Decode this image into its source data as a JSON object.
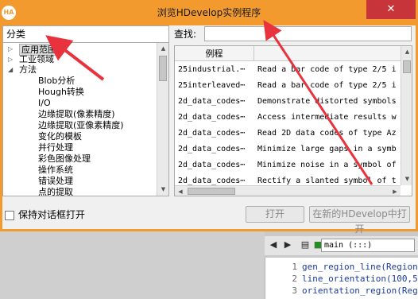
{
  "window": {
    "title": "浏览HDevelop实例程序",
    "app_icon_text": "HA",
    "close_symbol": "✕"
  },
  "left_pane": {
    "header": "分类",
    "tree": [
      {
        "label": "应用范围",
        "level": 0,
        "expanded": false,
        "selected": true
      },
      {
        "label": "工业领域",
        "level": 0,
        "expanded": false
      },
      {
        "label": "方法",
        "level": 0,
        "expanded": true
      },
      {
        "label": "Blob分析",
        "level": 1
      },
      {
        "label": "Hough转换",
        "level": 1
      },
      {
        "label": "I/O",
        "level": 1
      },
      {
        "label": "边缘提取(像素精度)",
        "level": 1
      },
      {
        "label": "边缘提取(亚像素精度)",
        "level": 1
      },
      {
        "label": "变化的模板",
        "level": 1
      },
      {
        "label": "并行处理",
        "level": 1
      },
      {
        "label": "彩色图像处理",
        "level": 1
      },
      {
        "label": "操作系统",
        "level": 1
      },
      {
        "label": "错误处理",
        "level": 1
      },
      {
        "label": "点的提取",
        "level": 1
      }
    ]
  },
  "right_pane": {
    "search_label": "查找:",
    "search_value": "",
    "column_header": "例程",
    "rows": [
      {
        "name": "25industrial.⋯",
        "description": "Read a bar code of type 2/5 i"
      },
      {
        "name": "25interleaved⋯",
        "description": "Read a bar code of type 2/5 i"
      },
      {
        "name": "2d_data_codes⋯",
        "description": "Demonstrate distorted symbols"
      },
      {
        "name": "2d_data_codes⋯",
        "description": "Access intermediate results w"
      },
      {
        "name": "2d_data_codes⋯",
        "description": "Read 2D data codes of type Az"
      },
      {
        "name": "2d_data_codes⋯",
        "description": "Minimize large gaps in a symb"
      },
      {
        "name": "2d_data_codes⋯",
        "description": "Minimize noise in a symbol of"
      },
      {
        "name": "2d_data_codes⋯",
        "description": "Rectify a slanted symbol of t"
      }
    ]
  },
  "footer": {
    "keep_open_label": "保持对话框打开",
    "keep_open_checked": false,
    "open_button": "打开",
    "open_new_button": "在新的HDevelop中打开"
  },
  "editor": {
    "procedure": "main (:::)",
    "lines": [
      {
        "number": "1",
        "code": "gen_region_line(Region"
      },
      {
        "number": "2",
        "code": "line_orientation(100,5"
      },
      {
        "number": "3",
        "code": "orientation_region(Reg"
      }
    ]
  },
  "colors": {
    "title_bar": "#f29a2e",
    "close_button": "#c7353a",
    "annotation_arrow": "#e8333e",
    "code_text": "#1b3b9c"
  },
  "icons": [
    "search-icon",
    "back-arrow-icon",
    "forward-arrow-icon",
    "document-icon",
    "code-run-icon"
  ]
}
